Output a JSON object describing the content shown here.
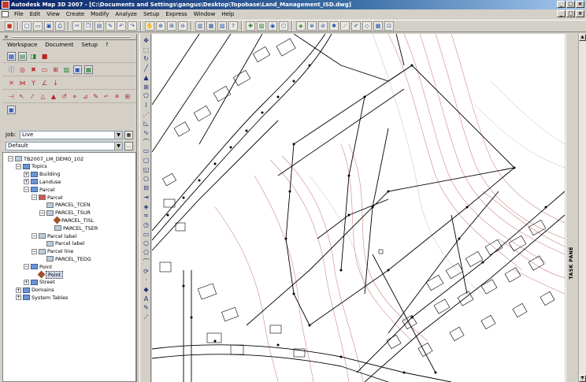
{
  "window": {
    "title": "Autodesk Map 3D 2007 - [C:\\Documents and Settings\\gangus\\Desktop\\Topobase\\Land_Management_ISD.dwg]",
    "min_label": "_",
    "max_label": "□",
    "close_label": "×"
  },
  "menu": {
    "items": [
      "File",
      "Edit",
      "View",
      "Create",
      "Modify",
      "Analyze",
      "Setup",
      "Express",
      "Window",
      "Help"
    ],
    "doc_min": "_",
    "doc_max": "□",
    "doc_close": "×"
  },
  "toolbar": {
    "icons": [
      "topobase-icon",
      "new-icon",
      "open-icon",
      "save-icon",
      "print-icon",
      "cut-icon",
      "copy-icon",
      "paste-icon",
      "match-icon",
      "undo-icon",
      "redo-icon",
      "pan-icon",
      "zoom-realtime-icon",
      "zoom-window-icon",
      "zoom-previous-icon",
      "properties-icon",
      "design-center-icon",
      "tool-palette-icon",
      "help-icon",
      "layer-icon",
      "layer-manager-icon",
      "query-icon",
      "select-icon",
      "map-icon",
      "attach-icon",
      "digitize-icon",
      "connect-icon",
      "brush-icon",
      "pencil-icon",
      "feature-icon",
      "table-icon",
      "edit-icon"
    ]
  },
  "panel": {
    "close_label": "×",
    "menu": [
      "Workspace",
      "Document",
      "Setup",
      "?"
    ],
    "job_label": "Job:",
    "job_value": "Live",
    "workspace_value": "Default",
    "more_button": "...",
    "arrow": "▼"
  },
  "tree": [
    {
      "id": "root",
      "label": "TB2007_LM_DEMO_102",
      "indent": 0,
      "exp": "−",
      "icon": "db"
    },
    {
      "id": "topics",
      "label": "Topics",
      "indent": 1,
      "exp": "−",
      "icon": "folder"
    },
    {
      "id": "building",
      "label": "Building",
      "indent": 2,
      "exp": "+",
      "icon": "folder"
    },
    {
      "id": "landuse",
      "label": "Landuse",
      "indent": 2,
      "exp": "+",
      "icon": "folder"
    },
    {
      "id": "parcel-folder",
      "label": "Parcel",
      "indent": 2,
      "exp": "−",
      "icon": "folder"
    },
    {
      "id": "parcel",
      "label": "Parcel",
      "indent": 3,
      "exp": "−",
      "icon": "red"
    },
    {
      "id": "parcel-tcen",
      "label": "PARCEL_TCEN",
      "indent": 4,
      "exp": "",
      "icon": "table"
    },
    {
      "id": "parcel-tsur",
      "label": "PARCEL_TSUR",
      "indent": 4,
      "exp": "−",
      "icon": "table"
    },
    {
      "id": "parcel-tisl",
      "label": "PARCEL_TISL",
      "indent": 5,
      "exp": "",
      "icon": "dia"
    },
    {
      "id": "parcel-tser",
      "label": "PARCEL_TSER",
      "indent": 5,
      "exp": "",
      "icon": "table"
    },
    {
      "id": "parcel-label-group",
      "label": "Parcel label",
      "indent": 3,
      "exp": "−",
      "icon": "table"
    },
    {
      "id": "parcel-label",
      "label": "Parcel label",
      "indent": 4,
      "exp": "",
      "icon": "table"
    },
    {
      "id": "parcel-line",
      "label": "Parcel line",
      "indent": 3,
      "exp": "−",
      "icon": "table"
    },
    {
      "id": "parcel-tedg",
      "label": "PARCEL_TEDG",
      "indent": 4,
      "exp": "",
      "icon": "table"
    },
    {
      "id": "point-folder",
      "label": "Point",
      "indent": 2,
      "exp": "−",
      "icon": "folder"
    },
    {
      "id": "point",
      "label": "Point",
      "indent": 3,
      "exp": "",
      "icon": "dia",
      "selected": true
    },
    {
      "id": "street",
      "label": "Street",
      "indent": 2,
      "exp": "+",
      "icon": "folder"
    },
    {
      "id": "domains",
      "label": "Domains",
      "indent": 1,
      "exp": "+",
      "icon": "folder"
    },
    {
      "id": "system-tables",
      "label": "System Tables",
      "indent": 1,
      "exp": "+",
      "icon": "folder"
    }
  ],
  "taskpane": {
    "label": "TASK PANE"
  },
  "scroll": {
    "up": "▲",
    "down": "▼"
  }
}
